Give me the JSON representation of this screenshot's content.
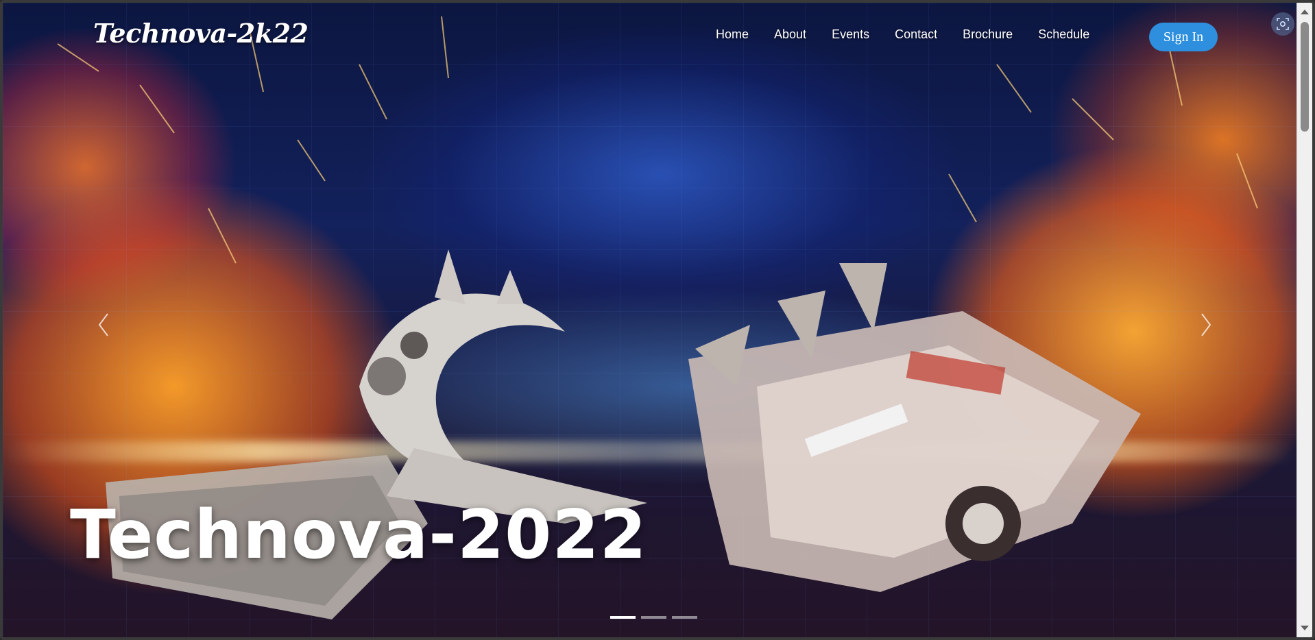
{
  "brand": {
    "logo_text": "Technova-2k22"
  },
  "nav": {
    "items": [
      {
        "label": "Home"
      },
      {
        "label": "About"
      },
      {
        "label": "Events"
      },
      {
        "label": "Contact"
      },
      {
        "label": "Brochure"
      },
      {
        "label": "Schedule"
      }
    ],
    "signin_label": "Sign In"
  },
  "hero": {
    "headline": "Technova-2022",
    "background_image": "battle-robots-with-flames-and-sparks",
    "slides": {
      "count": 3,
      "active_index": 0
    },
    "prev_icon": "chevron-left-icon",
    "next_icon": "chevron-right-icon"
  },
  "toolbar": {
    "corner_icon": "screenshot-capture-icon"
  },
  "colors": {
    "signin_bg": "#2d8fdd",
    "text": "#ffffff"
  }
}
